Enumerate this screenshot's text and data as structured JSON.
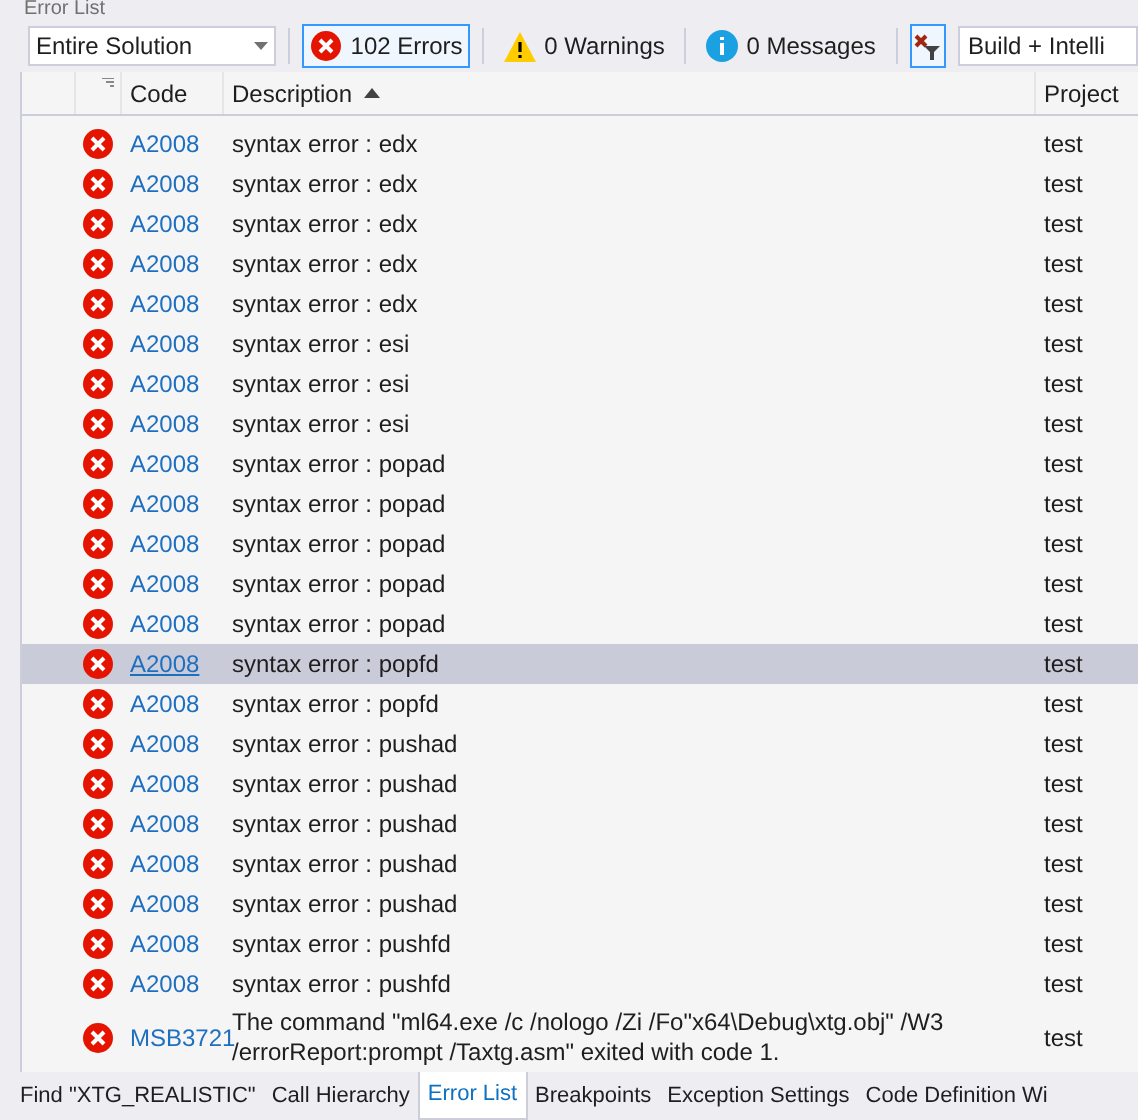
{
  "panel_title": "Error List",
  "toolbar": {
    "scope": "Entire Solution",
    "errors": {
      "label": "102 Errors",
      "selected": true
    },
    "warnings": {
      "label": "0 Warnings",
      "selected": false
    },
    "messages": {
      "label": "0 Messages",
      "selected": false
    },
    "filter_selected": true,
    "source": "Build + Intelli"
  },
  "columns": [
    "Code",
    "Description",
    "Project"
  ],
  "rows": [
    {
      "code": "A2008",
      "description": "syntax error : edx",
      "project": "test",
      "selected": false
    },
    {
      "code": "A2008",
      "description": "syntax error : edx",
      "project": "test",
      "selected": false
    },
    {
      "code": "A2008",
      "description": "syntax error : edx",
      "project": "test",
      "selected": false
    },
    {
      "code": "A2008",
      "description": "syntax error : edx",
      "project": "test",
      "selected": false
    },
    {
      "code": "A2008",
      "description": "syntax error : edx",
      "project": "test",
      "selected": false
    },
    {
      "code": "A2008",
      "description": "syntax error : esi",
      "project": "test",
      "selected": false
    },
    {
      "code": "A2008",
      "description": "syntax error : esi",
      "project": "test",
      "selected": false
    },
    {
      "code": "A2008",
      "description": "syntax error : esi",
      "project": "test",
      "selected": false
    },
    {
      "code": "A2008",
      "description": "syntax error : popad",
      "project": "test",
      "selected": false
    },
    {
      "code": "A2008",
      "description": "syntax error : popad",
      "project": "test",
      "selected": false
    },
    {
      "code": "A2008",
      "description": "syntax error : popad",
      "project": "test",
      "selected": false
    },
    {
      "code": "A2008",
      "description": "syntax error : popad",
      "project": "test",
      "selected": false
    },
    {
      "code": "A2008",
      "description": "syntax error : popad",
      "project": "test",
      "selected": false
    },
    {
      "code": "A2008",
      "description": "syntax error : popfd",
      "project": "test",
      "selected": true
    },
    {
      "code": "A2008",
      "description": "syntax error : popfd",
      "project": "test",
      "selected": false
    },
    {
      "code": "A2008",
      "description": "syntax error : pushad",
      "project": "test",
      "selected": false
    },
    {
      "code": "A2008",
      "description": "syntax error : pushad",
      "project": "test",
      "selected": false
    },
    {
      "code": "A2008",
      "description": "syntax error : pushad",
      "project": "test",
      "selected": false
    },
    {
      "code": "A2008",
      "description": "syntax error : pushad",
      "project": "test",
      "selected": false
    },
    {
      "code": "A2008",
      "description": "syntax error : pushad",
      "project": "test",
      "selected": false
    },
    {
      "code": "A2008",
      "description": "syntax error : pushfd",
      "project": "test",
      "selected": false
    },
    {
      "code": "A2008",
      "description": "syntax error : pushfd",
      "project": "test",
      "selected": false
    },
    {
      "code": "MSB3721",
      "description": "The command \"ml64.exe /c /nologo /Zi /Fo\"x64\\Debug\\xtg.obj\" /W3 /errorReport:prompt  /Taxtg.asm\" exited with code 1.",
      "project": "test",
      "selected": false
    }
  ],
  "tabs": [
    {
      "label": "Find \"XTG_REALISTIC\"",
      "selected": false
    },
    {
      "label": "Call Hierarchy",
      "selected": false
    },
    {
      "label": "Error List",
      "selected": true
    },
    {
      "label": "Breakpoints",
      "selected": false
    },
    {
      "label": "Exception Settings",
      "selected": false
    },
    {
      "label": "Code Definition Wi",
      "selected": false
    }
  ]
}
